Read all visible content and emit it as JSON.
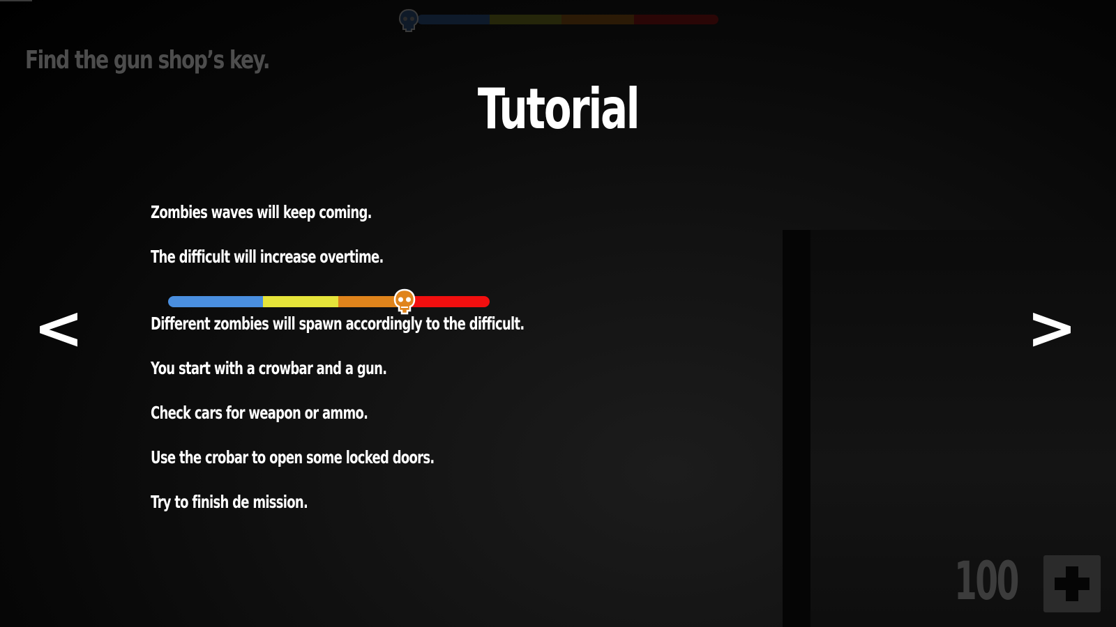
{
  "hud": {
    "objective": "Find the gun shop’s key.",
    "difficulty_bar": {
      "segments": [
        {
          "color": "#0e1a2a",
          "fraction": 0.24
        },
        {
          "color": "#25260a",
          "fraction": 0.24
        },
        {
          "color": "#2b1a06",
          "fraction": 0.24
        },
        {
          "color": "#2a0606",
          "fraction": 0.28
        }
      ],
      "icon": "zombie-skull-icon"
    },
    "health": {
      "value": "100",
      "icon": "health-cross-icon"
    }
  },
  "tutorial": {
    "title": "Tutorial",
    "lines": [
      "Zombies waves will keep coming.",
      "The difficult will increase overtime.",
      "Different zombies will spawn accordingly to the difficult.",
      "You start with a crowbar and a gun.",
      "Check cars for weapon or ammo.",
      "Use the crobar to open some locked doors.",
      "Try to finish de mission."
    ],
    "difficulty_bar": {
      "segments": [
        {
          "color": "#4a8fe0",
          "fraction": 0.295
        },
        {
          "color": "#e6e43a",
          "fraction": 0.235
        },
        {
          "color": "#e0841c",
          "fraction": 0.2
        },
        {
          "color": "#f20f0f",
          "fraction": 0.27
        }
      ],
      "marker_position": 0.735,
      "icon": "zombie-skull-icon"
    },
    "nav": {
      "prev_label": "<",
      "next_label": ">"
    }
  }
}
